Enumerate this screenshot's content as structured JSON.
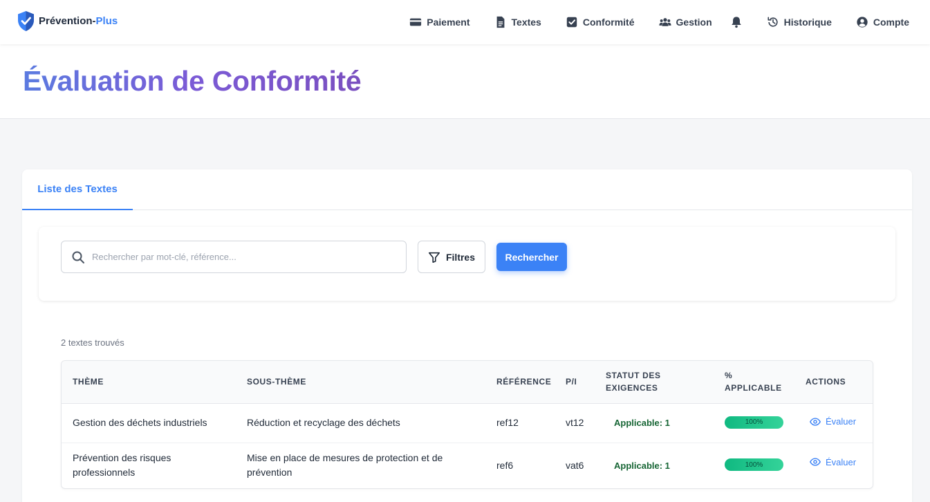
{
  "brand": {
    "name_main": "Prévention-",
    "name_accent": "Plus"
  },
  "nav": {
    "payment": "Paiement",
    "texts": "Textes",
    "compliance": "Conformité",
    "management": "Gestion",
    "history": "Historique",
    "account": "Compte"
  },
  "page": {
    "title": "Évaluation de Conformité"
  },
  "tabs": {
    "list": "Liste des Textes"
  },
  "search": {
    "placeholder": "Rechercher par mot-clé, référence...",
    "filters_label": "Filtres",
    "search_label": "Rechercher"
  },
  "results": {
    "count_text": "2 textes trouvés"
  },
  "table": {
    "headers": {
      "theme": "THÈME",
      "subtheme": "SOUS-THÈME",
      "reference": "RÉFÉRENCE",
      "pi": "P/I",
      "status": "STATUT DES EXIGENCES",
      "applicable": "% APPLICABLE",
      "actions": "ACTIONS"
    },
    "rows": [
      {
        "theme": "Gestion des déchets industriels",
        "subtheme": "Réduction et recyclage des déchets",
        "reference": "ref12",
        "pi": "vt12",
        "status": "Applicable: 1",
        "percent_label": "100%",
        "percent": 100,
        "action": "Évaluer"
      },
      {
        "theme": "Prévention des risques professionnels",
        "subtheme": "Mise en place de mesures de protection et de prévention",
        "reference": "ref6",
        "pi": "vat6",
        "status": "Applicable: 1",
        "percent_label": "100%",
        "percent": 100,
        "action": "Évaluer"
      }
    ]
  },
  "colors": {
    "accent": "#3b82f6",
    "success": "#10b981",
    "title_start": "#5b7be0",
    "title_end": "#7a4fc0"
  }
}
